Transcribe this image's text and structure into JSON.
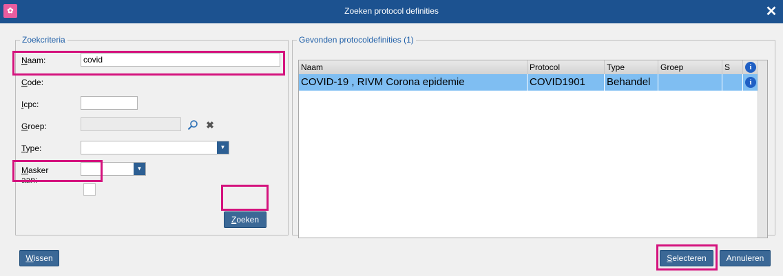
{
  "window": {
    "title": "Zoeken protocol definities",
    "app_icon": "app-logo-icon",
    "close": "close-icon"
  },
  "criteria": {
    "legend": "Zoekcriteria",
    "naam": {
      "label_u": "N",
      "label_rest": "aam:",
      "value": "covid"
    },
    "code": {
      "label_u": "C",
      "label_rest": "ode:",
      "value": ""
    },
    "icpc": {
      "label_u": "I",
      "label_rest": "cpc:",
      "value": ""
    },
    "groep": {
      "label_u": "G",
      "label_rest": "roep:",
      "value": ""
    },
    "type": {
      "label_u": "T",
      "label_rest": "ype:",
      "value": ""
    },
    "masker": {
      "label_u": "M",
      "label_rest": "asker aan:",
      "checked": false
    },
    "zoeken_u": "Z",
    "zoeken_rest": "oeken"
  },
  "results": {
    "legend": "Gevonden protocoldefinities (1)",
    "columns": [
      "Naam",
      "Protocol",
      "Type",
      "Groep",
      "S"
    ],
    "rows": [
      {
        "naam": "COVID-19 , RIVM Corona epidemie",
        "protocol": "COVID1901",
        "type": "Behandel",
        "groep": "",
        "s": ""
      }
    ]
  },
  "footer": {
    "wissen_u": "W",
    "wissen_rest": "issen",
    "selecteren_u": "S",
    "selecteren_rest": "electeren",
    "annuleren": "Annuleren"
  },
  "colors": {
    "titlebar": "#1c5290",
    "highlight": "#d4127d",
    "selection": "#7fbef2",
    "button": "#3b6896"
  }
}
